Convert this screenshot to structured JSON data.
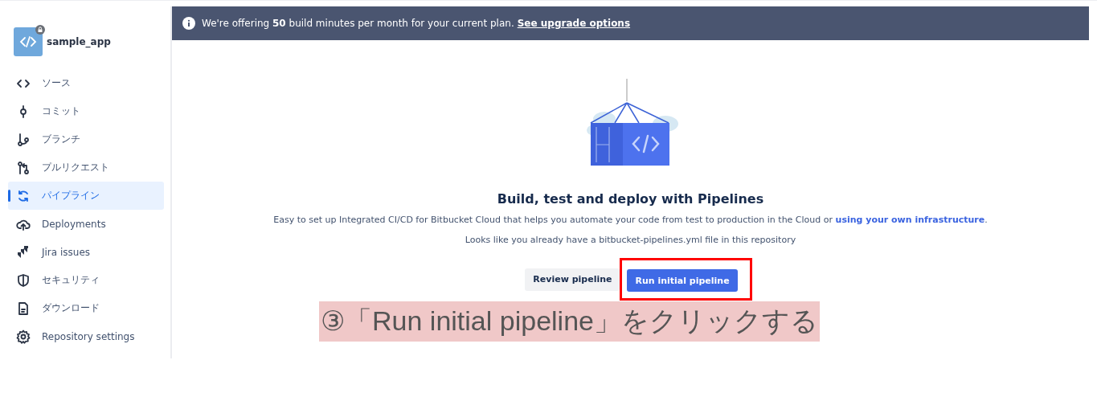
{
  "repository": {
    "name": "sample_app"
  },
  "sidebar": {
    "items": [
      {
        "label": "ソース",
        "selected": false
      },
      {
        "label": "コミット",
        "selected": false
      },
      {
        "label": "ブランチ",
        "selected": false
      },
      {
        "label": "プルリクエスト",
        "selected": false
      },
      {
        "label": "パイプライン",
        "selected": true
      },
      {
        "label": "Deployments",
        "selected": false
      },
      {
        "label": "Jira issues",
        "selected": false
      },
      {
        "label": "セキュリティ",
        "selected": false
      },
      {
        "label": "ダウンロード",
        "selected": false
      },
      {
        "label": "Repository settings",
        "selected": false
      }
    ]
  },
  "banner": {
    "text": "We're offering **50** build minutes per month for your current plan.",
    "link": "See upgrade options"
  },
  "empty_state": {
    "title": "Build, test and deploy with Pipelines",
    "description": "Easy to set up Integrated CI/CD for Bitbucket Cloud that helps you automate your code from test to production in the Cloud or",
    "description_link": "using your own infrastructure",
    "description_end": ".",
    "note": "Looks like you already have a bitbucket-pipelines.yml file in this repository",
    "buttons": [
      {
        "label": "Review pipeline",
        "kind": "secondary",
        "highlighted": false
      },
      {
        "label": "Run initial pipeline",
        "kind": "primary",
        "highlighted": true
      }
    ]
  },
  "annotation": {
    "text": "③「Run initial pipeline」をクリックする"
  }
}
